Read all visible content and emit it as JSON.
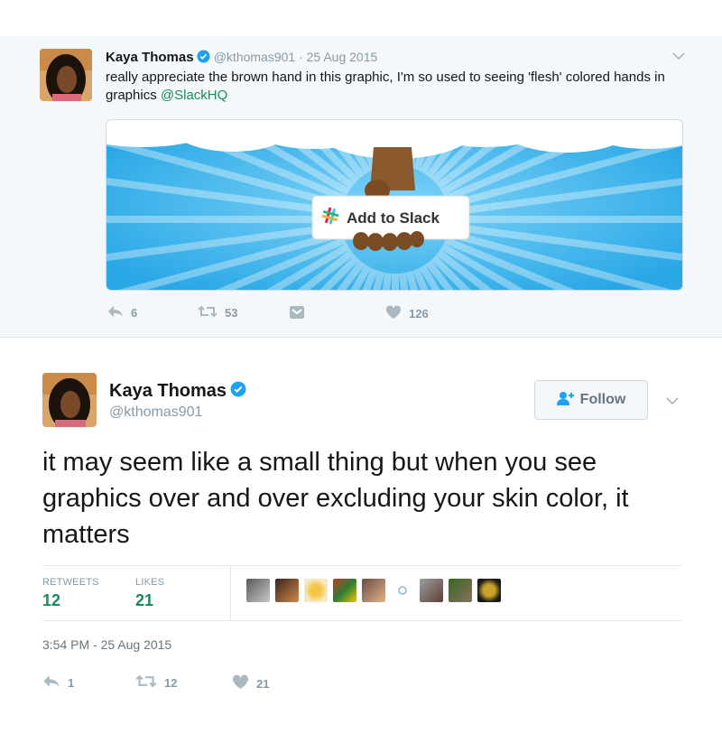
{
  "parent_tweet": {
    "author_name": "Kaya Thomas",
    "handle_date": "@kthomas901 · 25 Aug 2015",
    "text_before_mention": "really appreciate the brown hand in this graphic, I'm so used to seeing 'flesh' colored hands in graphics ",
    "mention": "@SlackHQ",
    "card_button_label": "Add to Slack",
    "replies": "6",
    "retweets": "53",
    "likes": "126"
  },
  "main_tweet": {
    "author_name": "Kaya Thomas",
    "handle": "@kthomas901",
    "follow_label": "Follow",
    "text": "it may seem like a small thing but when you see graphics over and over excluding your skin color, it matters",
    "retweets_label": "RETWEETS",
    "retweets_count": "12",
    "likes_label": "LIKES",
    "likes_count": "21",
    "timestamp": "3:54 PM - 25 Aug 2015",
    "replies": "1",
    "retweets": "12",
    "likes": "21"
  },
  "colors": {
    "verified": "#1da1f2",
    "link_green": "#1b8a5a",
    "muted": "#8899a6",
    "card_sky": "#3cb6ee",
    "skin": "#8a5a2e"
  },
  "icons": [
    "verified-icon",
    "chevron-down-icon",
    "reply-icon",
    "retweet-icon",
    "dm-icon",
    "heart-icon",
    "follow-person-plus-icon",
    "slack-logo-icon"
  ]
}
